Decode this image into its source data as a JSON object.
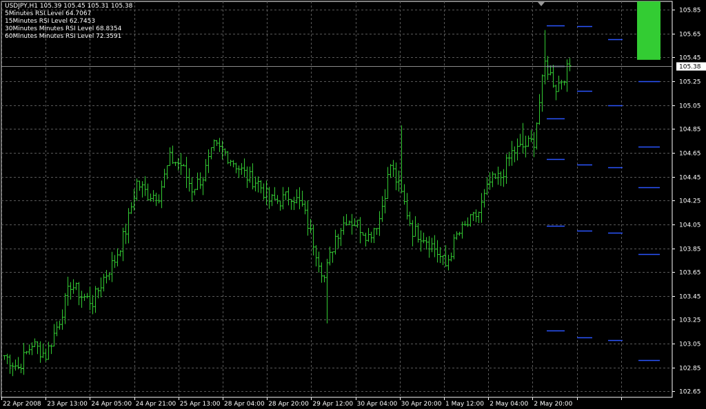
{
  "header": {
    "title": "USDJPY,H1  105.39 105.45 105.31 105.38",
    "lines": [
      "5Minutes RSI Level 64.7067",
      "15Minutes RSI Level 62.7453",
      "30Minutes Minutes RSI Level 68.8354",
      "60Minutes Minutes RSI Level 72.3591"
    ]
  },
  "colors": {
    "background": "#000000",
    "grid": "#5a5a5a",
    "candles": "#33cc33",
    "levels": "#2b55ff",
    "level_highlight": "#9fc4ff",
    "green_block": "#33cc33",
    "axis_text": "#ffffff",
    "current_price_line": "#8c8c8c"
  },
  "chart_data": {
    "type": "bar",
    "symbol": "USDJPY",
    "timeframe": "H1",
    "ylim": [
      102.6,
      105.92
    ],
    "y_ticks": [
      "105.85",
      "105.65",
      "105.45",
      "105.25",
      "105.05",
      "104.85",
      "104.65",
      "104.45",
      "104.25",
      "104.05",
      "103.85",
      "103.65",
      "103.45",
      "103.25",
      "103.05",
      "102.85",
      "102.65"
    ],
    "x_tick_labels": [
      "22 Apr 2008",
      "23 Apr 13:00",
      "24 Apr 05:00",
      "24 Apr 21:00",
      "25 Apr 13:00",
      "28 Apr 04:00",
      "28 Apr 20:00",
      "29 Apr 12:00",
      "30 Apr 04:00",
      "30 Apr 20:00",
      "1 May 12:00",
      "2 May 04:00",
      "2 May 20:00"
    ],
    "current_price": "105.38",
    "anchors": [
      [
        0,
        102.95
      ],
      [
        5,
        102.85
      ],
      [
        10,
        103.05
      ],
      [
        15,
        102.95
      ],
      [
        20,
        103.25
      ],
      [
        24,
        103.55
      ],
      [
        28,
        103.45
      ],
      [
        32,
        103.4
      ],
      [
        36,
        103.6
      ],
      [
        40,
        103.75
      ],
      [
        44,
        104.0
      ],
      [
        48,
        104.4
      ],
      [
        52,
        104.3
      ],
      [
        56,
        104.3
      ],
      [
        60,
        104.6
      ],
      [
        64,
        104.55
      ],
      [
        68,
        104.35
      ],
      [
        72,
        104.45
      ],
      [
        76,
        104.7
      ],
      [
        80,
        104.65
      ],
      [
        84,
        104.55
      ],
      [
        88,
        104.45
      ],
      [
        92,
        104.4
      ],
      [
        96,
        104.25
      ],
      [
        100,
        104.25
      ],
      [
        104,
        104.3
      ],
      [
        108,
        104.2
      ],
      [
        112,
        103.9
      ],
      [
        116,
        103.6
      ],
      [
        120,
        103.95
      ],
      [
        124,
        104.1
      ],
      [
        128,
        104.05
      ],
      [
        132,
        103.95
      ],
      [
        136,
        104.1
      ],
      [
        140,
        104.55
      ],
      [
        144,
        104.3
      ],
      [
        148,
        104.0
      ],
      [
        152,
        103.95
      ],
      [
        156,
        103.85
      ],
      [
        160,
        103.7
      ],
      [
        164,
        103.95
      ],
      [
        168,
        104.05
      ],
      [
        172,
        104.15
      ],
      [
        176,
        104.4
      ],
      [
        180,
        104.45
      ],
      [
        184,
        104.65
      ],
      [
        188,
        104.7
      ],
      [
        192,
        104.75
      ],
      [
        196,
        105.4
      ],
      [
        200,
        105.2
      ],
      [
        203,
        105.3
      ],
      [
        205,
        105.38
      ]
    ],
    "green_block": {
      "from": 105.43,
      "to": 105.92
    },
    "levels": [
      {
        "col": 0,
        "values": [
          105.72,
          105.38,
          104.94,
          104.6,
          104.04,
          103.16
        ]
      },
      {
        "col": 1,
        "values": [
          105.71,
          105.17,
          104.55,
          104.0,
          103.1
        ]
      },
      {
        "col": 2,
        "values": [
          105.6,
          105.05,
          104.53,
          103.98,
          103.08
        ]
      },
      {
        "col": 3,
        "values": [
          105.25,
          104.7,
          104.36,
          103.8,
          102.91
        ]
      }
    ]
  }
}
